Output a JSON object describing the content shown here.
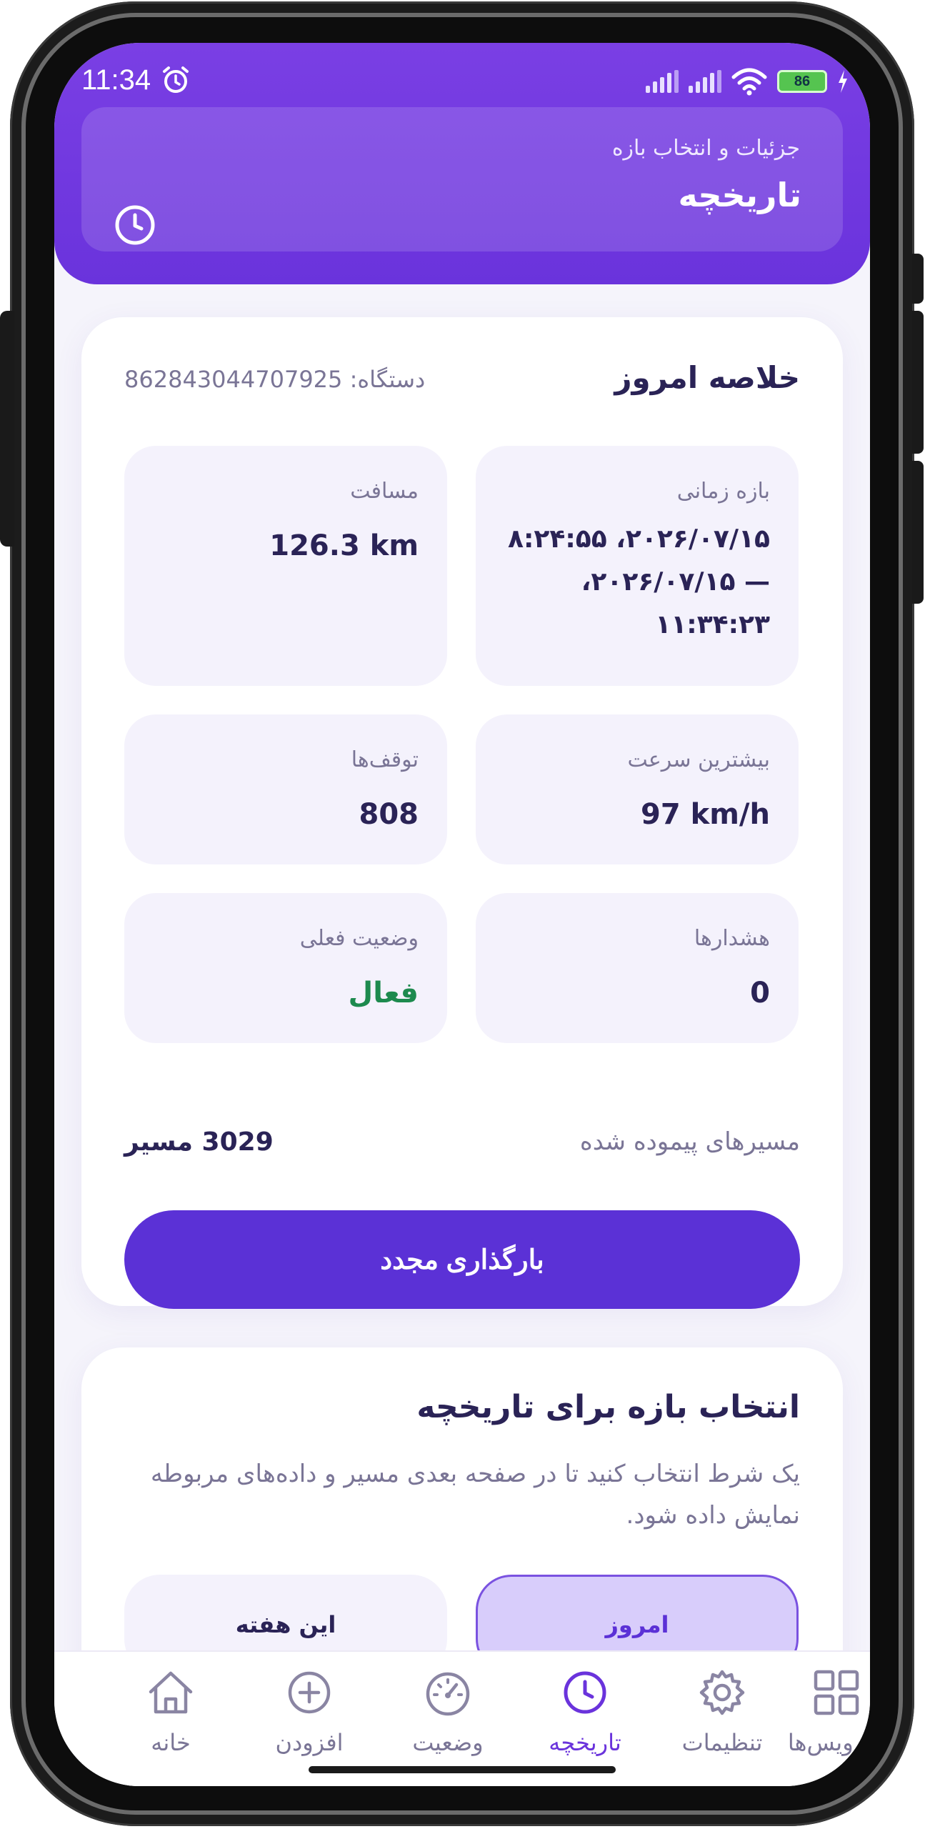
{
  "status_bar": {
    "time": "11:34",
    "battery": "86"
  },
  "header": {
    "subtitle": "جزئیات و انتخاب بازه",
    "title": "تاریخچه",
    "icon": "clock-icon"
  },
  "summary": {
    "title": "خلاصه امروز",
    "device_label": "دستگاه: 862843044707925",
    "tiles": [
      {
        "label": "بازه زمانی",
        "value": "۲۰۲۶/۰۷/۱۵، ۸:۲۴:۵۵ — ۲۰۲۶/۰۷/۱۵، ۱۱:۳۴:۲۳"
      },
      {
        "label": "مسافت",
        "value": "126.3 km"
      },
      {
        "label": "بیشترین سرعت",
        "value": "97 km/h"
      },
      {
        "label": "توقف‌ها",
        "value": "808"
      },
      {
        "label": "هشدارها",
        "value": "0"
      },
      {
        "label": "وضعیت فعلی",
        "value": "فعال"
      }
    ],
    "routes_label": "مسیرهای پیموده شده",
    "routes_value": "3029 مسیر",
    "reload_button": "بارگذاری مجدد"
  },
  "range": {
    "title": "انتخاب بازه برای تاریخچه",
    "description": "یک شرط انتخاب کنید تا در صفحه بعدی مسیر و داده‌های مربوطه نمایش داده شود.",
    "options": [
      {
        "label": "امروز",
        "selected": true
      },
      {
        "label": "این هفته",
        "selected": false
      }
    ]
  },
  "bottom_nav": [
    {
      "label": "خانه",
      "icon": "home-icon",
      "active": false
    },
    {
      "label": "افزودن",
      "icon": "plus-circle-icon",
      "active": false
    },
    {
      "label": "وضعیت",
      "icon": "speedometer-icon",
      "active": false
    },
    {
      "label": "تاریخچه",
      "icon": "clock-icon",
      "active": true
    },
    {
      "label": "تنظیمات",
      "icon": "gear-icon",
      "active": false
    },
    {
      "label": "سرویس‌ها",
      "icon": "grid-icon",
      "active": false
    }
  ],
  "colors": {
    "primary": "#5b31d6",
    "header": "#6a33dc",
    "active_green": "#1d8a4e"
  }
}
